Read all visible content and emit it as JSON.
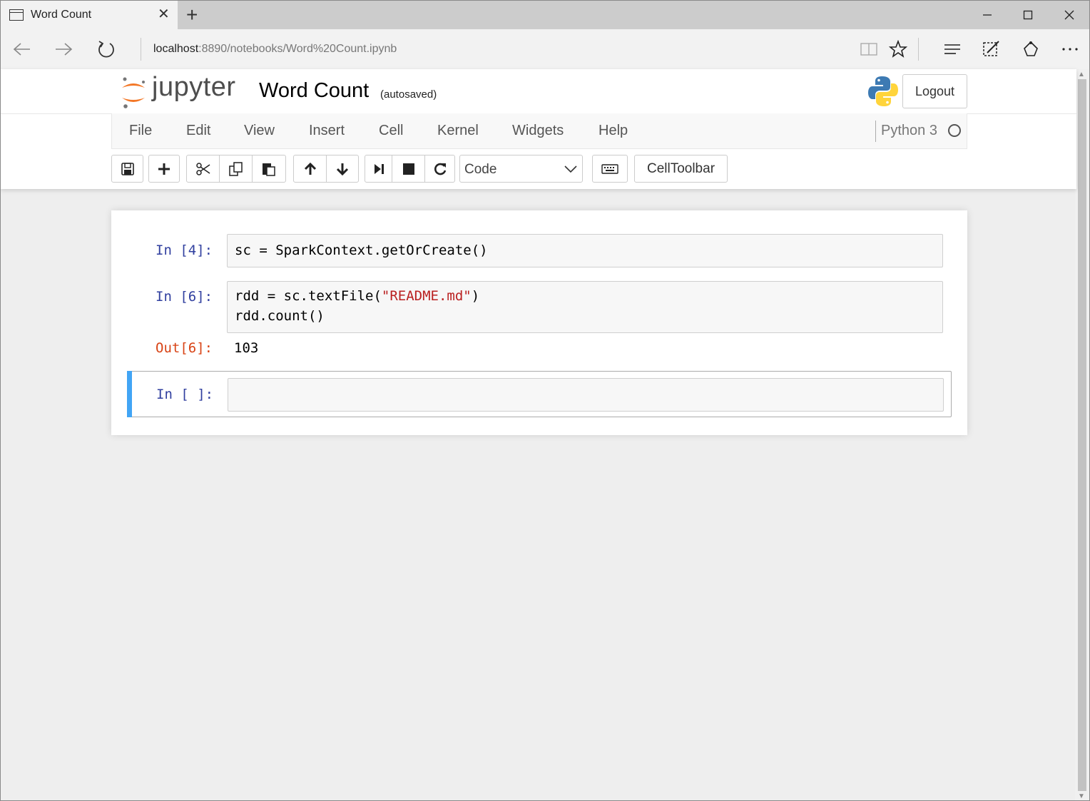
{
  "browser": {
    "tab_title": "Word Count",
    "url_host": "localhost",
    "url_rest": ":8890/notebooks/Word%20Count.ipynb",
    "icons": [
      "page-icon",
      "close-icon",
      "new-tab-icon",
      "minimize-icon",
      "maximize-icon",
      "window-close-icon",
      "back-icon",
      "forward-icon",
      "refresh-icon",
      "reading-view-icon",
      "favorite-star-icon",
      "hub-icon",
      "web-note-icon",
      "share-icon",
      "more-icon"
    ]
  },
  "header": {
    "logo_text": "jupyter",
    "notebook_name": "Word Count",
    "autosave_status": "(autosaved)",
    "logout_label": "Logout"
  },
  "menu": {
    "items": [
      "File",
      "Edit",
      "View",
      "Insert",
      "Cell",
      "Kernel",
      "Widgets",
      "Help"
    ],
    "kernel_name": "Python 3"
  },
  "toolbar": {
    "cell_type": "Code",
    "celltoolbar_label": "CellToolbar",
    "icons": [
      "save-icon",
      "insert-cell-icon",
      "cut-icon",
      "copy-icon",
      "paste-icon",
      "move-up-icon",
      "move-down-icon",
      "run-icon",
      "interrupt-icon",
      "restart-icon",
      "keyboard-icon"
    ]
  },
  "cells": [
    {
      "prompt": "In [4]:",
      "lines": [
        "sc = SparkContext.getOrCreate()"
      ]
    },
    {
      "prompt": "In [6]:",
      "line1_pre": "rdd = sc.textFile(",
      "line1_str": "\"README.md\"",
      "line1_post": ")",
      "line2": "rdd.count()",
      "out_prompt": "Out[6]:",
      "output": "103"
    },
    {
      "prompt": "In [ ]:",
      "code": ""
    }
  ],
  "colors": {
    "in_prompt": "#303f9f",
    "out_prompt": "#d84315",
    "string": "#ba2121",
    "selected_cell": "#42a5f5",
    "jupyter_orange": "#f37726"
  }
}
